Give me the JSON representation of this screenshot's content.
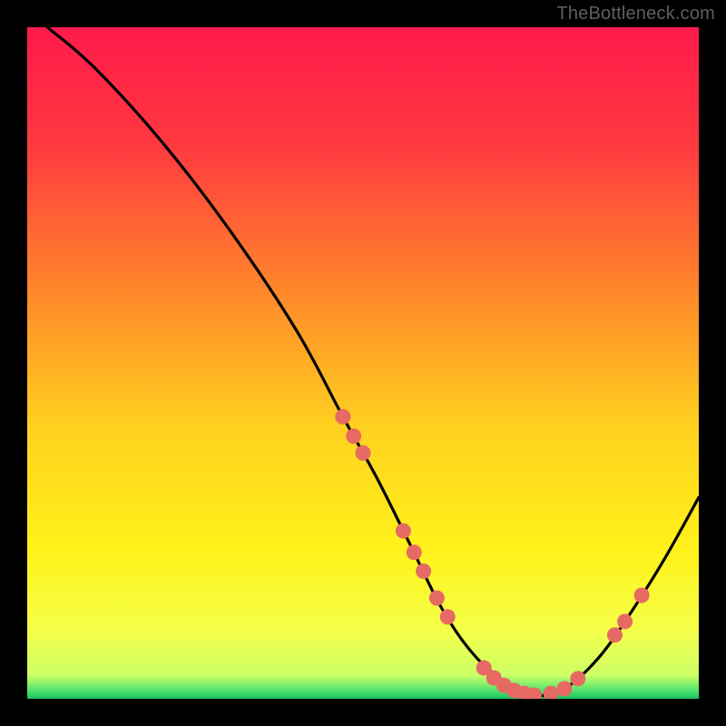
{
  "watermark": "TheBottleneck.com",
  "chart_data": {
    "type": "line",
    "title": "",
    "xlabel": "",
    "ylabel": "",
    "xlim": [
      0,
      100
    ],
    "ylim": [
      0,
      100
    ],
    "series": [
      {
        "name": "curve",
        "x": [
          3,
          10,
          20,
          30,
          40,
          47,
          52,
          57,
          62,
          67,
          72,
          76,
          80,
          85,
          90,
          95,
          100
        ],
        "y": [
          100,
          94,
          83,
          70,
          55,
          42,
          33,
          23,
          13,
          6,
          2,
          0.5,
          1.5,
          6,
          13,
          21,
          30
        ]
      }
    ],
    "markers": {
      "name": "highlight-dots",
      "color": "#e66a63",
      "points": [
        {
          "x": 47.0,
          "y": 42.0
        },
        {
          "x": 48.6,
          "y": 39.1
        },
        {
          "x": 50.0,
          "y": 36.6
        },
        {
          "x": 56.0,
          "y": 25.0
        },
        {
          "x": 57.6,
          "y": 21.8
        },
        {
          "x": 59.0,
          "y": 19.0
        },
        {
          "x": 61.0,
          "y": 15.0
        },
        {
          "x": 62.6,
          "y": 12.2
        },
        {
          "x": 68.0,
          "y": 4.6
        },
        {
          "x": 69.5,
          "y": 3.1
        },
        {
          "x": 71.0,
          "y": 2.0
        },
        {
          "x": 72.5,
          "y": 1.25
        },
        {
          "x": 74.0,
          "y": 0.8
        },
        {
          "x": 75.5,
          "y": 0.55
        },
        {
          "x": 78.0,
          "y": 0.8
        },
        {
          "x": 80.0,
          "y": 1.5
        },
        {
          "x": 82.0,
          "y": 3.0
        },
        {
          "x": 87.5,
          "y": 9.5
        },
        {
          "x": 89.0,
          "y": 11.5
        },
        {
          "x": 91.5,
          "y": 15.4
        }
      ]
    },
    "gradient_stops": [
      {
        "offset": 0.0,
        "color": "#ff1a4b"
      },
      {
        "offset": 0.18,
        "color": "#ff3a3f"
      },
      {
        "offset": 0.4,
        "color": "#ff8a2a"
      },
      {
        "offset": 0.6,
        "color": "#ffd21f"
      },
      {
        "offset": 0.78,
        "color": "#fff21a"
      },
      {
        "offset": 0.9,
        "color": "#f4ff4a"
      },
      {
        "offset": 0.965,
        "color": "#ccff66"
      },
      {
        "offset": 0.99,
        "color": "#44e06e"
      },
      {
        "offset": 1.0,
        "color": "#18c05a"
      }
    ]
  }
}
